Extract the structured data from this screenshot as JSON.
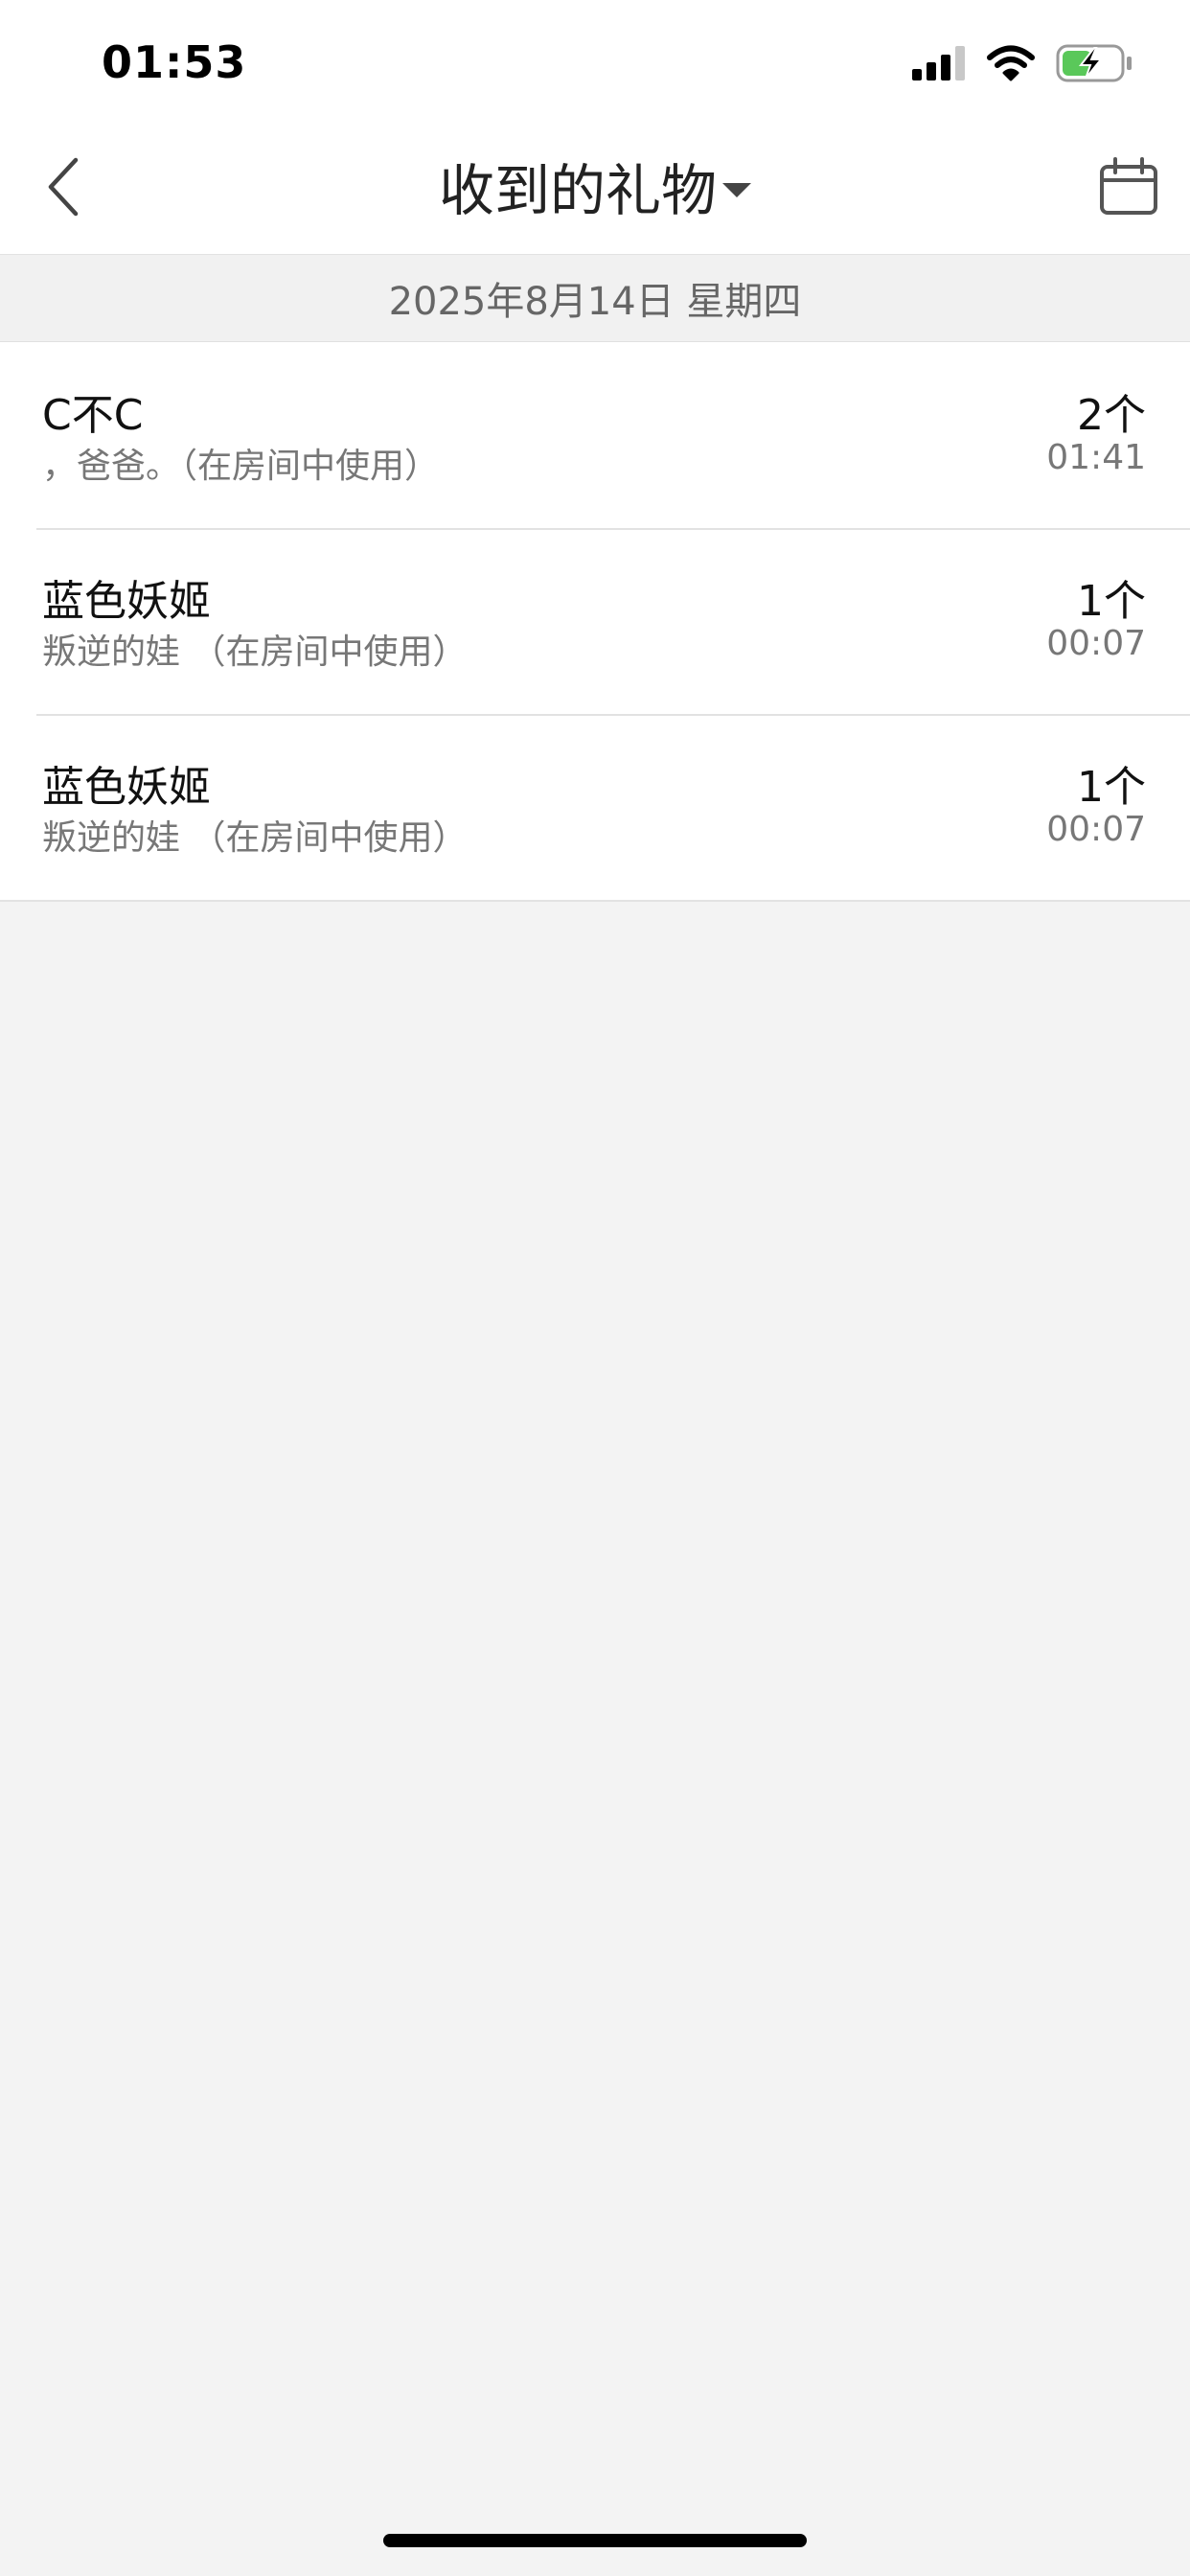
{
  "status_bar": {
    "time": "01:53"
  },
  "nav": {
    "title": "收到的礼物"
  },
  "date_header": "2025年8月14日 星期四",
  "gifts": [
    {
      "name": "C不C",
      "sender": "，爸爸。（在房间中使用）",
      "count": "2个",
      "time": "01:41"
    },
    {
      "name": "蓝色妖姬",
      "sender": "叛逆的娃 （在房间中使用）",
      "count": "1个",
      "time": "00:07"
    },
    {
      "name": "蓝色妖姬",
      "sender": "叛逆的娃 （在房间中使用）",
      "count": "1个",
      "time": "00:07"
    }
  ],
  "icons": {
    "back": "chevron-left-icon",
    "calendar": "calendar-icon",
    "signal": "cellular-signal-icon",
    "wifi": "wifi-icon",
    "battery": "battery-charging-icon"
  },
  "colors": {
    "background": "#f3f3f3",
    "battery_fill": "#5ac85a"
  }
}
